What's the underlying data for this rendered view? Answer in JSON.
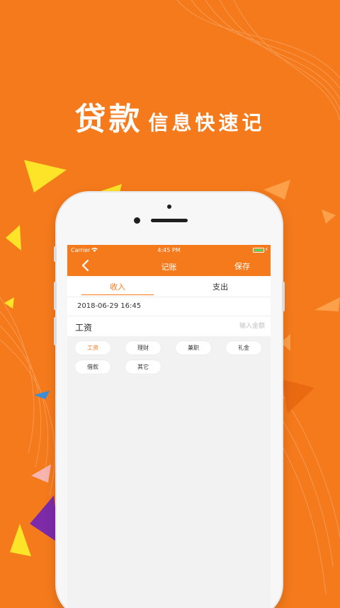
{
  "headline": {
    "big": "贷款",
    "small": "信息快速记"
  },
  "colors": {
    "brand": "#f57a1c",
    "battery": "#4cd964",
    "deco_yellow": "#fde428",
    "deco_purple": "#7d2ba8"
  },
  "status_bar": {
    "carrier": "Carrier",
    "time": "4:45 PM"
  },
  "nav": {
    "title": "记账",
    "save_label": "保存",
    "back_icon": "chevron-left-icon"
  },
  "tabs": [
    {
      "label": "收入",
      "active": true
    },
    {
      "label": "支出",
      "active": false
    }
  ],
  "entry": {
    "datetime": "2018-06-29 16:45",
    "category": "工资",
    "amount_placeholder": "输入金额"
  },
  "categories": [
    {
      "label": "工资",
      "selected": true
    },
    {
      "label": "理财",
      "selected": false
    },
    {
      "label": "兼职",
      "selected": false
    },
    {
      "label": "礼金",
      "selected": false
    },
    {
      "label": "借款",
      "selected": false
    },
    {
      "label": "其它",
      "selected": false
    }
  ]
}
